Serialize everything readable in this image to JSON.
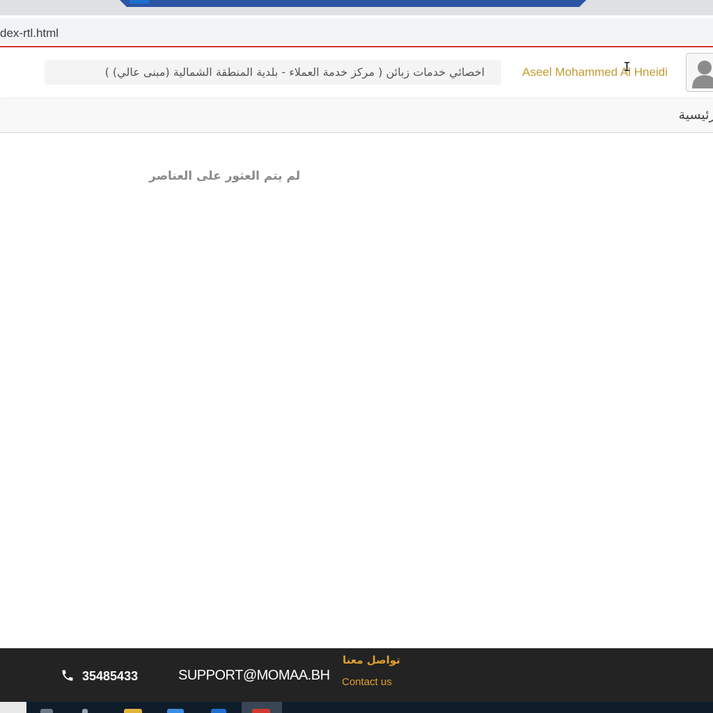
{
  "browser": {
    "url": "dex-rtl.html"
  },
  "header": {
    "job_title": "اخصائي خدمات زبائن ( مركز خدمة العملاء - بلدية المنطقة الشمالية (مبنى عالي) )",
    "user_name": "Aseel Mohammed Al Hneidi",
    "avatar_icon": "user-icon",
    "accent_color": "#c39a32"
  },
  "nav": {
    "home_label": "الرئيسية"
  },
  "main": {
    "empty_message": "لم يتم العثور على العناصر"
  },
  "footer": {
    "phone_icon": "phone-icon",
    "phone": "35485433",
    "email": "SUPPORT@MOMAA.BH",
    "contact_ar": "تواصل معنا",
    "contact_en": "Contact us",
    "accent_color": "#e0a02a"
  },
  "taskbar": {
    "icons": [
      "search-icon",
      "task-view-icon",
      "file-explorer-icon",
      "store-icon",
      "edge-icon",
      "chrome-icon"
    ]
  }
}
